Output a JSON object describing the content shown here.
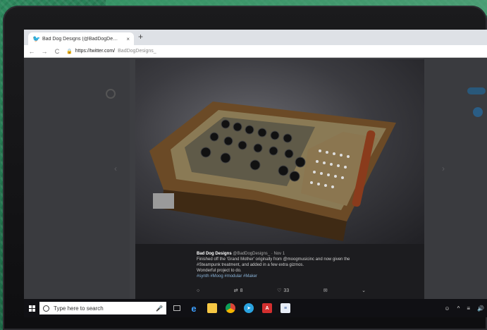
{
  "browser": {
    "tab_title": "Bad Dog Designs (@BadDogDe…",
    "tab_close": "×",
    "new_tab": "+",
    "back": "←",
    "forward": "→",
    "reload": "C",
    "url_host": "https://twitter.com/",
    "url_path": "BadDogDesigns_"
  },
  "tweet": {
    "author": "Bad Dog Designs",
    "handle": "@BadDogDesigns_ · Nov 1",
    "lines": [
      "Finished off the 'Grand Mother' originally from @moogmusicinc and now given the",
      "#Steampunk treatment, and added in a few extra gizmos.",
      "Wonderful project to do."
    ],
    "hashtags": "#synth #Moog #modular #Maker",
    "actions": {
      "reply": "",
      "retweet_count": "8",
      "like_count": "33",
      "message": ""
    }
  },
  "taskbar": {
    "search_placeholder": "Type here to search",
    "tray_text": "^"
  },
  "colors": {
    "twitter_blue": "#1da1f2",
    "taskbar": "#101014",
    "background_green": "#1f6b4a"
  }
}
